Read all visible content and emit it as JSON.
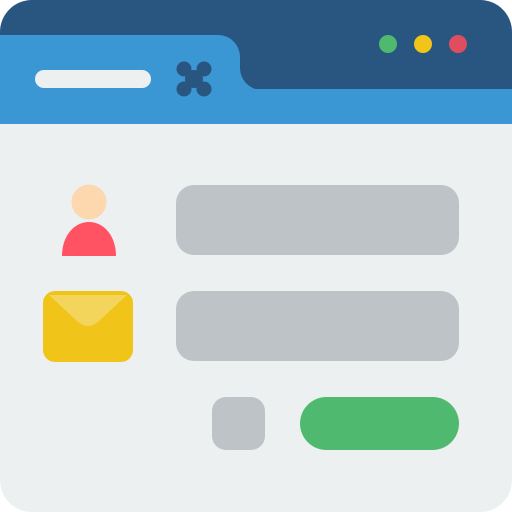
{
  "window": {
    "tab": {
      "title": "",
      "close_icon": "close-icon"
    },
    "controls": [
      {
        "name": "green-dot",
        "color": "#4FBA6F"
      },
      {
        "name": "yellow-dot",
        "color": "#F0C419"
      },
      {
        "name": "red-dot",
        "color": "#DF4D60"
      }
    ]
  },
  "form": {
    "name_field": {
      "icon": "user-icon",
      "value": "",
      "placeholder": ""
    },
    "email_field": {
      "icon": "mail-icon",
      "value": "",
      "placeholder": ""
    },
    "secondary_button": {
      "label": ""
    },
    "submit_button": {
      "label": ""
    }
  },
  "colors": {
    "titlebar": "#285680",
    "tab": "#3B97D3",
    "background": "#ECF0F1",
    "field": "#BDC3C7",
    "accent": "#4FBA6F"
  }
}
